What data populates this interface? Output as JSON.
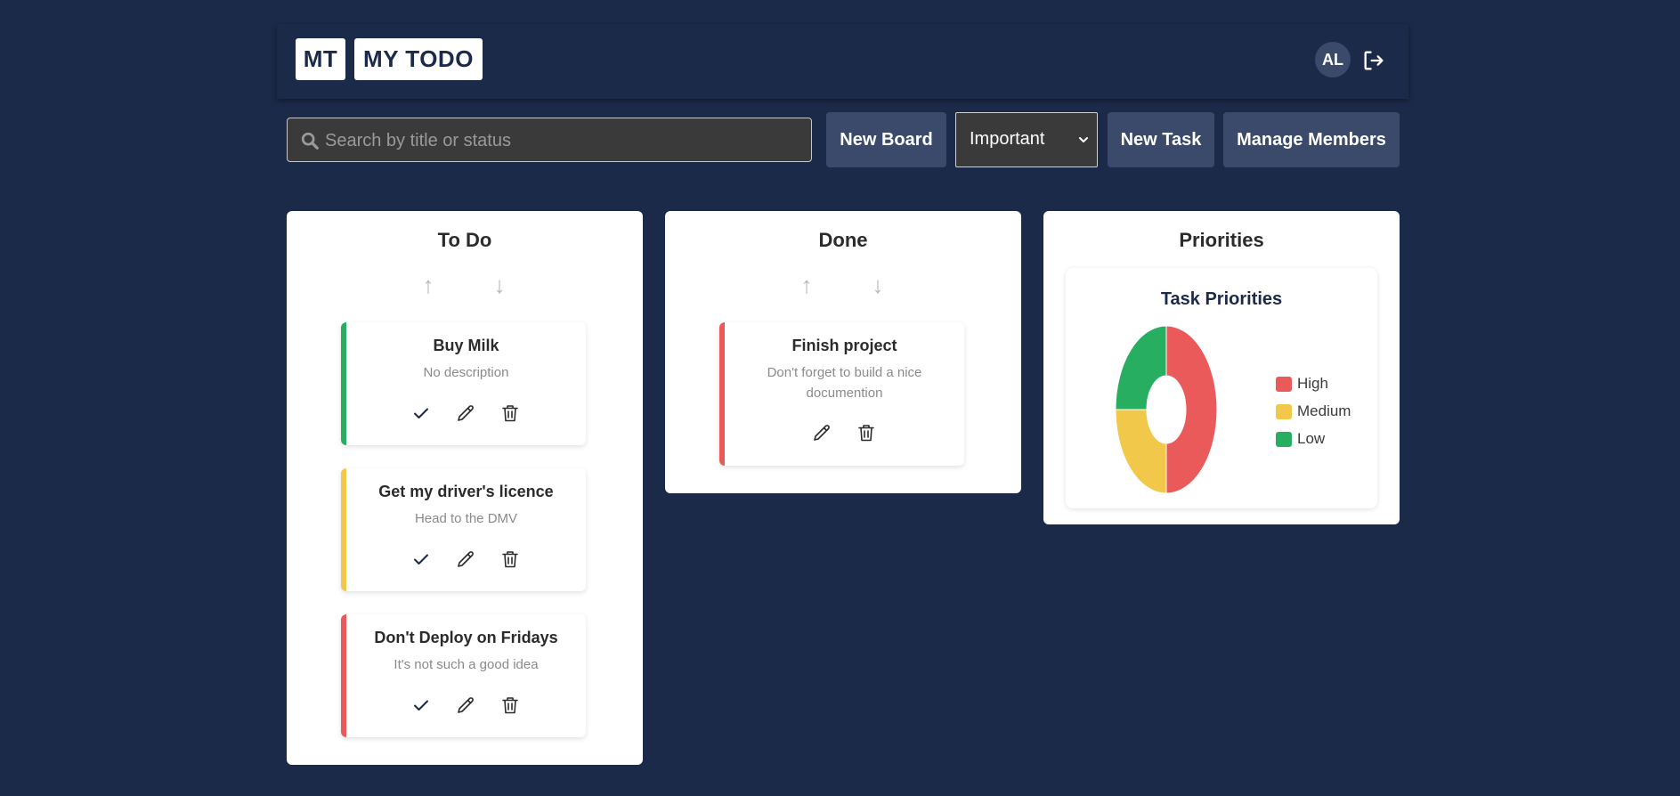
{
  "header": {
    "logo_short": "MT",
    "logo_title": "MY TODO",
    "avatar_initials": "AL",
    "logout_icon": "logout-icon"
  },
  "toolbar": {
    "search_placeholder": "Search by title or status",
    "new_board_label": "New Board",
    "filter_selected": "Important",
    "new_task_label": "New Task",
    "manage_members_label": "Manage Members"
  },
  "columns": [
    {
      "title": "To Do",
      "tasks": [
        {
          "title": "Buy Milk",
          "description": "No description",
          "priority": "Low"
        },
        {
          "title": "Get my driver's licence",
          "description": "Head to the DMV",
          "priority": "Medium"
        },
        {
          "title": "Don't Deploy on Fridays",
          "description": "It's not such a good idea",
          "priority": "High"
        }
      ]
    },
    {
      "title": "Done",
      "tasks": [
        {
          "title": "Finish project",
          "description": "Don't forget to build a nice documention",
          "priority": "High"
        }
      ]
    }
  ],
  "priorities_panel": {
    "title": "Priorities"
  },
  "colors": {
    "background": "#1c2a4a",
    "high": "#ea5a5a",
    "medium": "#f2c84b",
    "low": "#27ae60"
  },
  "chart_data": {
    "type": "pie",
    "title": "Task Priorities",
    "categories": [
      "High",
      "Medium",
      "Low"
    ],
    "values": [
      2,
      1,
      1
    ],
    "colors": [
      "#ea5a5a",
      "#f2c84b",
      "#27ae60"
    ],
    "donut": true,
    "legend_position": "right"
  }
}
